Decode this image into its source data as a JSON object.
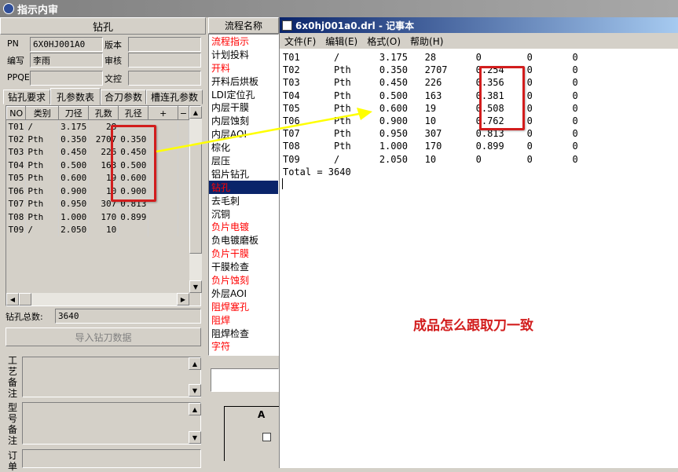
{
  "window_title": "指示内审",
  "left": {
    "section_title": "钻孔",
    "pn_label": "PN",
    "pn_value": "6X0HJ001A0",
    "version_label": "版本",
    "author_label": "编写",
    "author_value": "李雨",
    "review_label": "审核",
    "ppqe_label": "PPQE",
    "doc_control_label": "文控",
    "tabs": [
      "钻孔要求",
      "孔参数表",
      "合刀参数",
      "槽连孔参数"
    ],
    "table": {
      "headers": [
        "NO",
        "类别",
        "刀径",
        "孔数",
        "孔径",
        "+",
        "−"
      ],
      "rows": [
        [
          "T01",
          "/",
          "3.175",
          "28",
          ""
        ],
        [
          "T02",
          "Pth",
          "0.350",
          "2707",
          "0.350"
        ],
        [
          "T03",
          "Pth",
          "0.450",
          "226",
          "0.450"
        ],
        [
          "T04",
          "Pth",
          "0.500",
          "163",
          "0.500"
        ],
        [
          "T05",
          "Pth",
          "0.600",
          "19",
          "0.600"
        ],
        [
          "T06",
          "Pth",
          "0.900",
          "10",
          "0.900"
        ],
        [
          "T07",
          "Pth",
          "0.950",
          "307",
          "0.813"
        ],
        [
          "T08",
          "Pth",
          "1.000",
          "170",
          "0.899"
        ],
        [
          "T09",
          "/",
          "2.050",
          "10",
          ""
        ]
      ]
    },
    "total_label": "钻孔总数:",
    "total_value": "3640",
    "import_button": "导入钻刀数据",
    "process_note_label": "工艺备注",
    "model_note_label": "型号备注",
    "order_label": "订单"
  },
  "flow": {
    "header": "流程名称",
    "items": [
      {
        "label": "流程指示",
        "color": "red"
      },
      {
        "label": "计划投料",
        "color": "black"
      },
      {
        "label": "开料",
        "color": "red"
      },
      {
        "label": "开料后烘板",
        "color": "black"
      },
      {
        "label": "LDI定位孔",
        "color": "black"
      },
      {
        "label": "内层干膜",
        "color": "black"
      },
      {
        "label": "内层蚀刻",
        "color": "black"
      },
      {
        "label": "内层AOI",
        "color": "black"
      },
      {
        "label": "棕化",
        "color": "black"
      },
      {
        "label": "层压",
        "color": "black"
      },
      {
        "label": "铝片钻孔",
        "color": "black"
      },
      {
        "label": "钻孔",
        "color": "red",
        "selected": true
      },
      {
        "label": "去毛刺",
        "color": "black"
      },
      {
        "label": "沉铜",
        "color": "black"
      },
      {
        "label": "负片电镀",
        "color": "red"
      },
      {
        "label": "负电镀磨板",
        "color": "black"
      },
      {
        "label": "负片干膜",
        "color": "red"
      },
      {
        "label": "干膜检查",
        "color": "black"
      },
      {
        "label": "负片蚀刻",
        "color": "red"
      },
      {
        "label": "外层AOI",
        "color": "black"
      },
      {
        "label": "阻焊塞孔",
        "color": "red"
      },
      {
        "label": "阻焊",
        "color": "red"
      },
      {
        "label": "阻焊检查",
        "color": "black"
      },
      {
        "label": "字符",
        "color": "red"
      }
    ],
    "preview_label": "A"
  },
  "notepad": {
    "title": "6x0hj001a0.drl - 记事本",
    "menu": [
      "文件(F)",
      "编辑(E)",
      "格式(O)",
      "帮助(H)"
    ],
    "lines": [
      [
        "T01",
        "/",
        "3.175",
        "28",
        "0",
        "0",
        "0"
      ],
      [
        "T02",
        "Pth",
        "0.350",
        "2707",
        "0.254",
        "0",
        "0"
      ],
      [
        "T03",
        "Pth",
        "0.450",
        "226",
        "0.356",
        "0",
        "0"
      ],
      [
        "T04",
        "Pth",
        "0.500",
        "163",
        "0.381",
        "0",
        "0"
      ],
      [
        "T05",
        "Pth",
        "0.600",
        "19",
        "0.508",
        "0",
        "0"
      ],
      [
        "T06",
        "Pth",
        "0.900",
        "10",
        "0.762",
        "0",
        "0"
      ],
      [
        "T07",
        "Pth",
        "0.950",
        "307",
        "0.813",
        "0",
        "0"
      ],
      [
        "T08",
        "Pth",
        "1.000",
        "170",
        "0.899",
        "0",
        "0"
      ],
      [
        "T09",
        "/",
        "2.050",
        "10",
        "0",
        "0",
        "0"
      ]
    ],
    "total_line": "Total = 3640"
  },
  "annotation": "成品怎么跟取刀一致",
  "colors": {
    "annotation_red": "#d21d1d",
    "arrow_yellow": "#ffff00",
    "selected_bg": "#0a246a",
    "flow_red": "#ff0000"
  }
}
